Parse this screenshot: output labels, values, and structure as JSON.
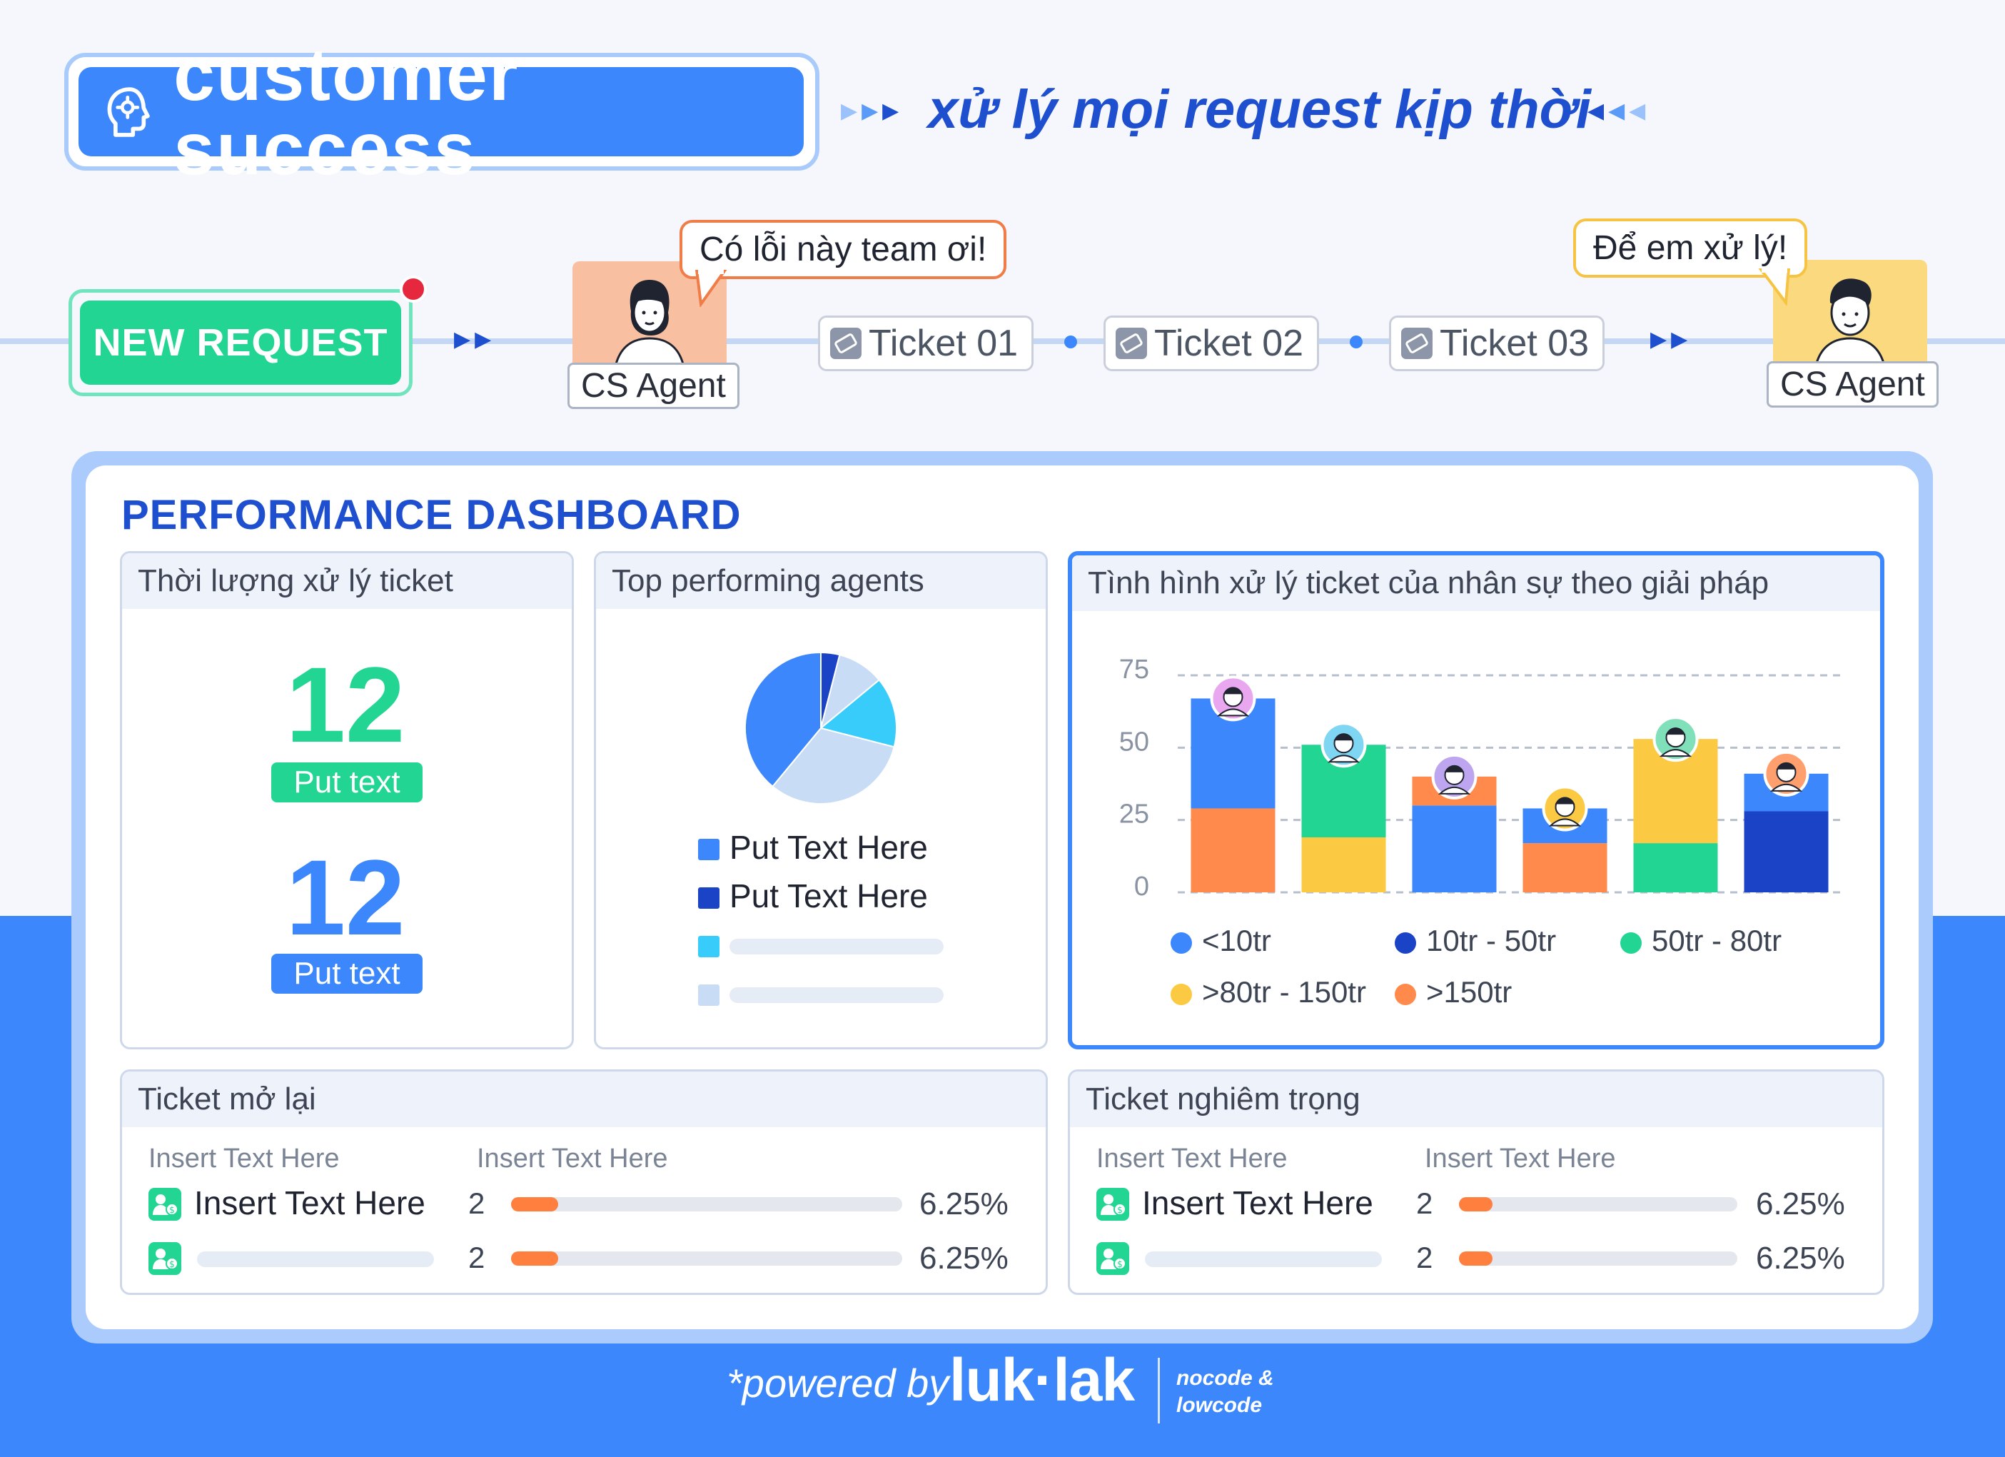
{
  "header": {
    "title": "customer success",
    "tagline": "xử lý mọi request kịp thời"
  },
  "flow": {
    "new_request": "NEW REQUEST",
    "agent1": {
      "label": "CS Agent",
      "speech": "Có lỗi này team ơi!"
    },
    "tickets": [
      "Ticket 01",
      "Ticket 02",
      "Ticket 03"
    ],
    "agent2": {
      "label": "CS Agent",
      "speech": "Để em xử lý!"
    }
  },
  "dashboard": {
    "title": "PERFORMANCE DASHBOARD",
    "duration": {
      "title": "Thời lượng xử lý ticket",
      "metrics": [
        {
          "value": "12",
          "label": "Put text",
          "color": "#22d593"
        },
        {
          "value": "12",
          "label": "Put text",
          "color": "#3b87fb"
        }
      ]
    },
    "top_agents": {
      "title": "Top performing agents",
      "legend": [
        {
          "label": "Put Text Here",
          "color": "#3b87fb"
        },
        {
          "label": "Put Text Here",
          "color": "#1a43c6"
        },
        {
          "label": "",
          "color": "#38ccfa"
        },
        {
          "label": "",
          "color": "#c9dcf5"
        }
      ]
    },
    "status": {
      "title": "Tình hình xử lý ticket của nhân sự theo giải pháp"
    },
    "reopened": {
      "title": "Ticket mở lại",
      "col1": "Insert Text Here",
      "col2": "Insert Text Here",
      "rows": [
        {
          "label": "Insert Text Here",
          "count": "2",
          "percent": "6.25%",
          "fraction": 0.12
        },
        {
          "label": "",
          "count": "2",
          "percent": "6.25%",
          "fraction": 0.12
        }
      ]
    },
    "critical": {
      "title": "Ticket nghiêm trọng",
      "col1": "Insert Text Here",
      "col2": "Insert Text Here",
      "rows": [
        {
          "label": "Insert Text Here",
          "count": "2",
          "percent": "6.25%",
          "fraction": 0.12
        },
        {
          "label": "",
          "count": "2",
          "percent": "6.25%",
          "fraction": 0.12
        }
      ]
    }
  },
  "pie_data": {
    "type": "pie",
    "slices": [
      {
        "value": 4,
        "color": "#1a43c6"
      },
      {
        "value": 10,
        "color": "#c9dcf5"
      },
      {
        "value": 15,
        "color": "#38ccfa"
      },
      {
        "value": 32,
        "color": "#c9dcf5"
      },
      {
        "value": 39,
        "color": "#3b87fb"
      }
    ]
  },
  "chart_data": {
    "type": "bar",
    "stacked": true,
    "ylim": [
      0,
      75
    ],
    "yticks": [
      0,
      25,
      50,
      75
    ],
    "grid": true,
    "legend_position": "bottom",
    "legend": [
      {
        "name": "<10tr",
        "color": "#3b87fb"
      },
      {
        "name": "10tr - 50tr",
        "color": "#1a43c6"
      },
      {
        "name": "50tr - 80tr",
        "color": "#22d593"
      },
      {
        "name": ">80tr - 150tr",
        "color": "#fcc942"
      },
      {
        "name": ">150tr",
        "color": "#ff8a4c"
      }
    ],
    "bars": [
      {
        "segments": [
          {
            "series": ">150tr",
            "value": 29
          },
          {
            "series": "<10tr",
            "value": 38
          }
        ],
        "avatar": "#e9a7ef"
      },
      {
        "segments": [
          {
            "series": ">80tr - 150tr",
            "value": 19
          },
          {
            "series": "50tr - 80tr",
            "value": 32
          }
        ],
        "avatar": "#7fd6f2"
      },
      {
        "segments": [
          {
            "series": "<10tr",
            "value": 30
          },
          {
            "series": ">150tr",
            "value": 10
          }
        ],
        "avatar": "#bda6ef"
      },
      {
        "segments": [
          {
            "series": ">150tr",
            "value": 17
          },
          {
            "series": "<10tr",
            "value": 12
          }
        ],
        "avatar": "#fcc942"
      },
      {
        "segments": [
          {
            "series": "50tr - 80tr",
            "value": 17
          },
          {
            "series": ">80tr - 150tr",
            "value": 36
          }
        ],
        "avatar": "#7fe0b9"
      },
      {
        "segments": [
          {
            "series": "10tr - 50tr",
            "value": 28
          },
          {
            "series": "<10tr",
            "value": 13
          }
        ],
        "avatar": "#ff9f6e"
      }
    ]
  },
  "footer": {
    "powered": "*powered by",
    "brand": "luk·lak",
    "note_line1": "nocode &",
    "note_line2": "lowcode"
  }
}
